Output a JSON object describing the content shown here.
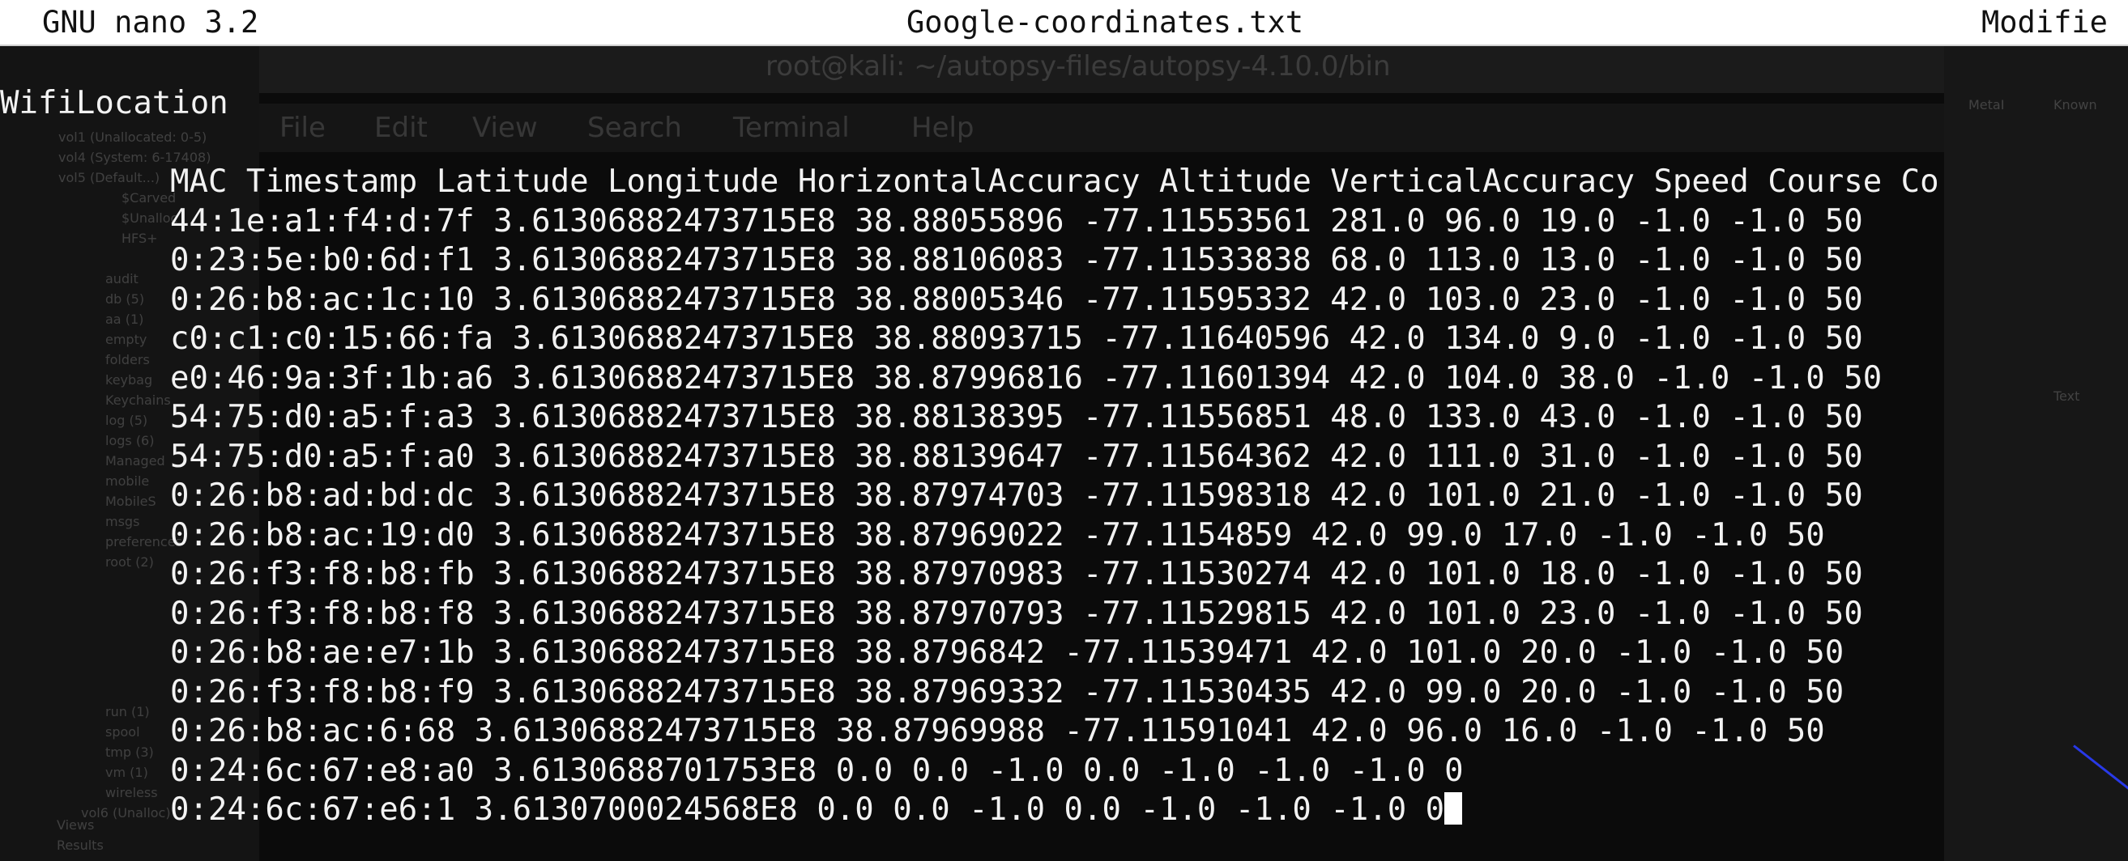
{
  "nano": {
    "app_version": "GNU nano 3.2",
    "filename": "Google-coordinates.txt",
    "status": "Modifie"
  },
  "background_window": {
    "title": "root@kali: ~/autopsy-files/autopsy-4.10.0/bin",
    "menu": [
      "File",
      "Edit",
      "View",
      "Search",
      "Terminal",
      "Help"
    ],
    "tree_items": [
      "vol1 (Unallocated: 0-5)",
      "vol4 (System: 6-17408)",
      "vol5 (Default...)",
      "$Carved",
      "$Unalloc",
      "HFS+",
      "audit",
      "db (5)",
      "aa (1)",
      "empty",
      "folders",
      "keybag",
      "Keychains",
      "log (5)",
      "logs (6)",
      "Managed",
      "mobile",
      "MobileS",
      "msgs",
      "preferences",
      "root (2)",
      "run (1)",
      "spool",
      "tmp (3)",
      "vm (1)",
      "wireless",
      "vol6 (Unalloc)",
      "Views",
      "Results"
    ],
    "right_panel": [
      "MetaI",
      "Known",
      "Text"
    ]
  },
  "file": {
    "section": "WifiLocation",
    "header": "MAC Timestamp Latitude Longitude HorizontalAccuracy Altitude VerticalAccuracy Speed Course Co",
    "rows": [
      "44:1e:a1:f4:d:7f 3.61306882473715E8 38.88055896 -77.11553561 281.0 96.0 19.0 -1.0 -1.0 50",
      "0:23:5e:b0:6d:f1 3.61306882473715E8 38.88106083 -77.11533838 68.0 113.0 13.0 -1.0 -1.0 50",
      "0:26:b8:ac:1c:10 3.61306882473715E8 38.88005346 -77.11595332 42.0 103.0 23.0 -1.0 -1.0 50",
      "c0:c1:c0:15:66:fa 3.61306882473715E8 38.88093715 -77.11640596 42.0 134.0 9.0 -1.0 -1.0 50",
      "e0:46:9a:3f:1b:a6 3.61306882473715E8 38.87996816 -77.11601394 42.0 104.0 38.0 -1.0 -1.0 50",
      "54:75:d0:a5:f:a3 3.61306882473715E8 38.88138395 -77.11556851 48.0 133.0 43.0 -1.0 -1.0 50",
      "54:75:d0:a5:f:a0 3.61306882473715E8 38.88139647 -77.11564362 42.0 111.0 31.0 -1.0 -1.0 50",
      "0:26:b8:ad:bd:dc 3.61306882473715E8 38.87974703 -77.11598318 42.0 101.0 21.0 -1.0 -1.0 50",
      "0:26:b8:ac:19:d0 3.61306882473715E8 38.87969022 -77.1154859 42.0 99.0 17.0 -1.0 -1.0 50",
      "0:26:f3:f8:b8:fb 3.61306882473715E8 38.87970983 -77.11530274 42.0 101.0 18.0 -1.0 -1.0 50",
      "0:26:f3:f8:b8:f8 3.61306882473715E8 38.87970793 -77.11529815 42.0 101.0 23.0 -1.0 -1.0 50",
      "0:26:b8:ae:e7:1b 3.61306882473715E8 38.8796842 -77.11539471 42.0 101.0 20.0 -1.0 -1.0 50",
      "0:26:f3:f8:b8:f9 3.61306882473715E8 38.87969332 -77.11530435 42.0 99.0 20.0 -1.0 -1.0 50",
      "0:26:b8:ac:6:68 3.61306882473715E8 38.87969988 -77.11591041 42.0 96.0 16.0 -1.0 -1.0 50",
      "0:24:6c:67:e8:a0 3.6130688701753E8 0.0 0.0 -1.0 0.0 -1.0 -1.0 -1.0 0",
      "0:24:6c:67:e6:1 3.6130700024568E8 0.0 0.0 -1.0 0.0 -1.0 -1.0 -1.0 0"
    ]
  }
}
